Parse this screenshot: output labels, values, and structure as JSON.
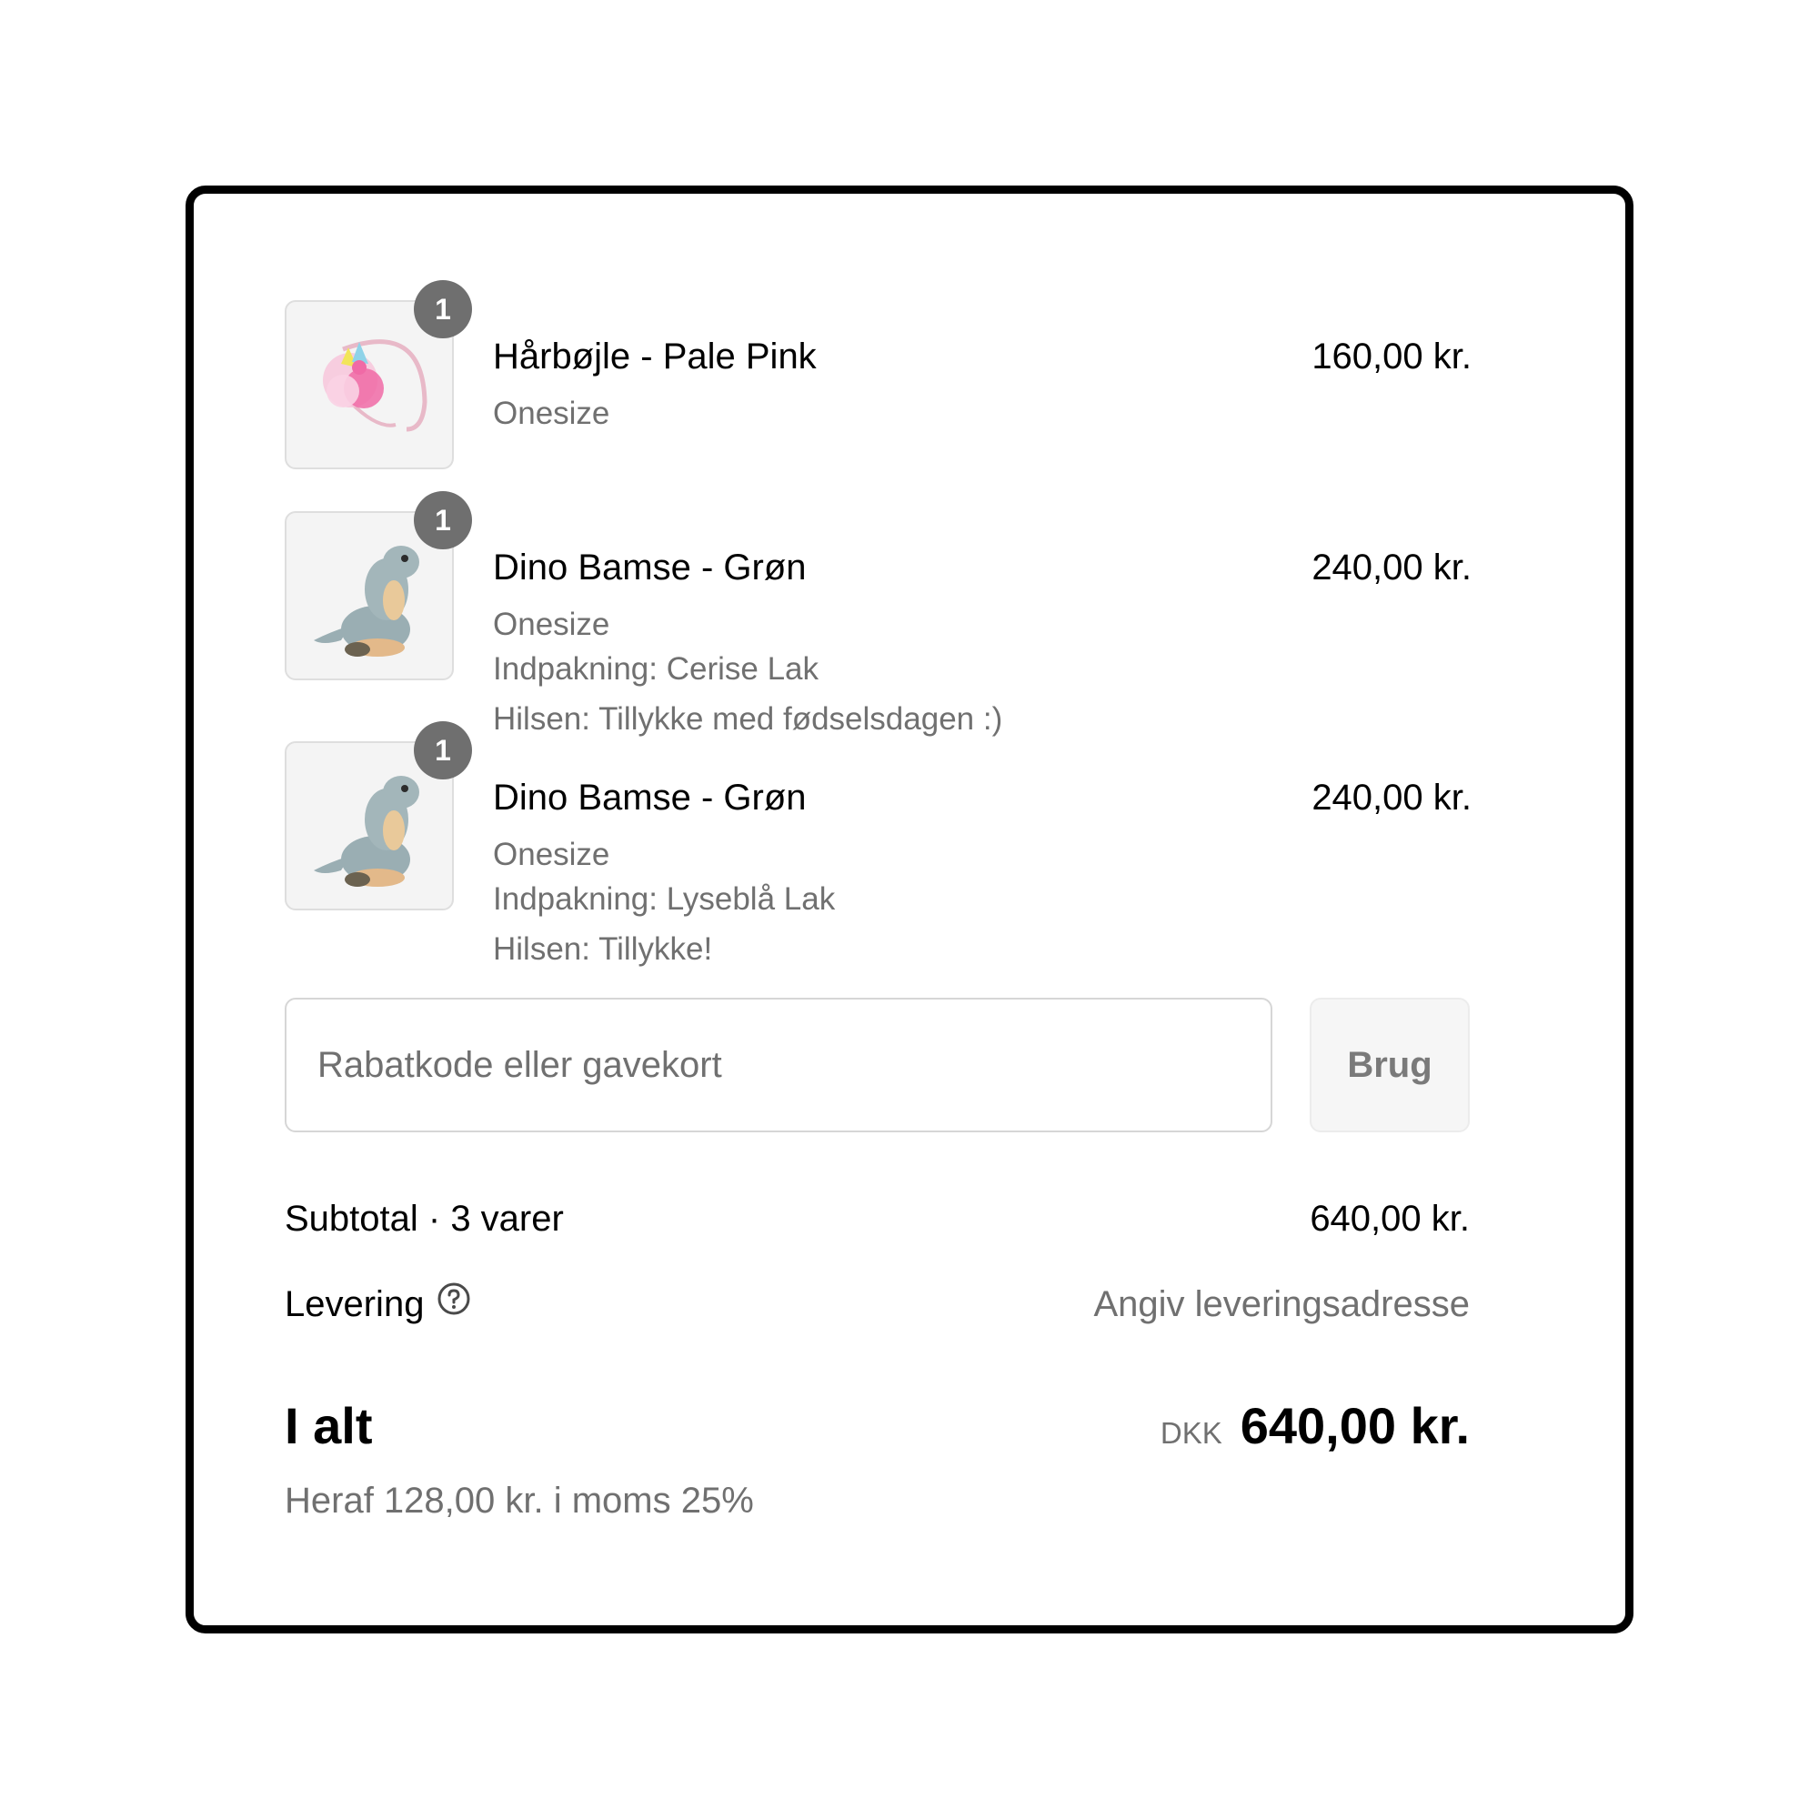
{
  "items": [
    {
      "quantity": "1",
      "name": "Hårbøjle - Pale Pink",
      "price": "160,00 kr.",
      "details": [
        "Onesize"
      ],
      "image_icon": "pink-headband-image"
    },
    {
      "quantity": "1",
      "name": "Dino Bamse - Grøn",
      "price": "240,00 kr.",
      "details": [
        "Onesize",
        "Indpakning: Cerise Lak",
        "Hilsen: Tillykke med fødselsdagen :)"
      ],
      "image_icon": "dino-plush-image"
    },
    {
      "quantity": "1",
      "name": "Dino Bamse - Grøn",
      "price": "240,00 kr.",
      "details": [
        "Onesize",
        "Indpakning: Lyseblå Lak",
        "Hilsen: Tillykke!"
      ],
      "image_icon": "dino-plush-image"
    }
  ],
  "discount": {
    "placeholder": "Rabatkode eller gavekort",
    "value": "",
    "apply_label": "Brug"
  },
  "summary": {
    "subtotal_label": "Subtotal · 3 varer",
    "subtotal_value": "640,00 kr.",
    "shipping_label": "Levering",
    "shipping_value": "Angiv leveringsadresse",
    "shipping_icon": "question-circle-icon",
    "total_label": "I alt",
    "currency": "DKK",
    "total_value": "640,00 kr.",
    "tax_note": "Heraf 128,00 kr. i moms 25%"
  },
  "colors": {
    "text": "#000000",
    "muted": "#707070",
    "badge": "#6f6f6f",
    "border": "#d6d6d6",
    "thumb_bg": "#f4f4f4"
  }
}
